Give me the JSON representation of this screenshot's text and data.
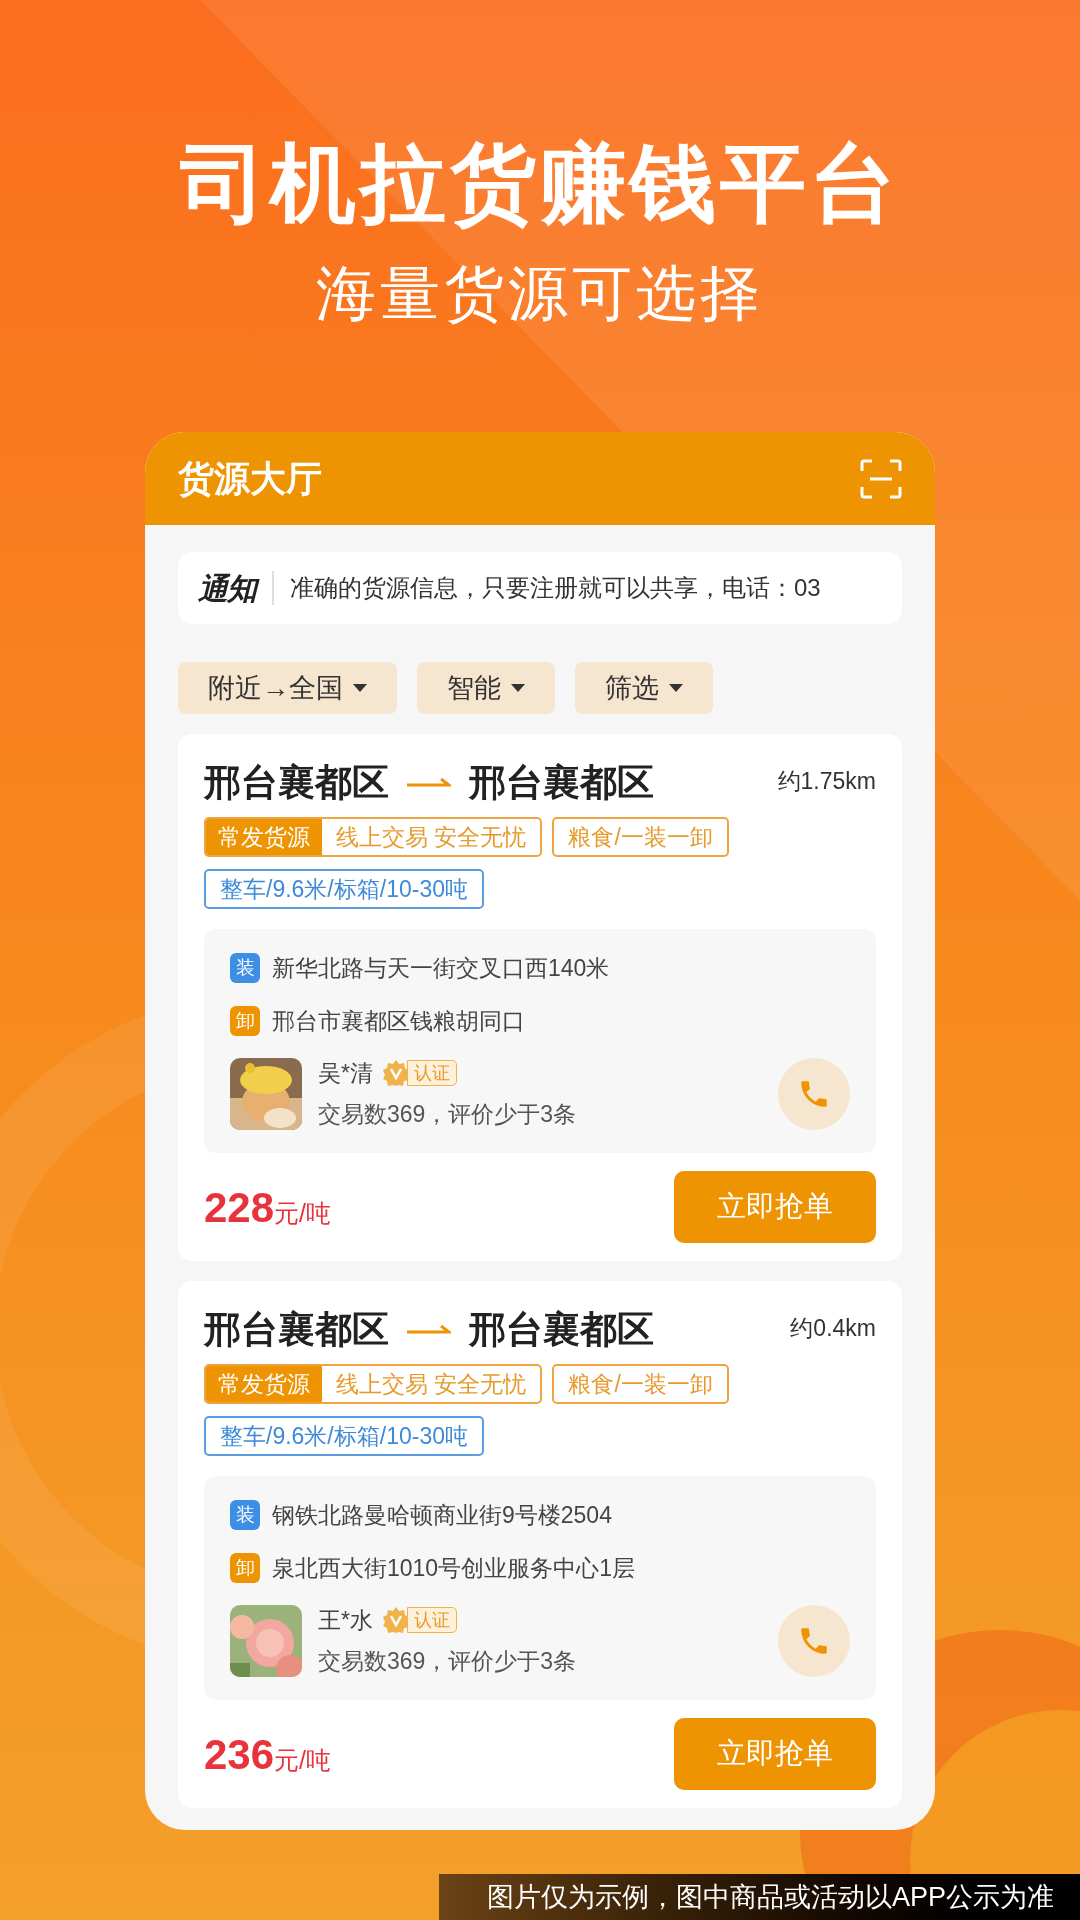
{
  "headline": "司机拉货赚钱平台",
  "subheadline": "海量货源可选择",
  "app": {
    "title": "货源大厅",
    "notice": {
      "label": "通知",
      "text": "准确的货源信息，只要注册就可以共享，电话：03"
    },
    "filters": [
      "附近→全国",
      "智能",
      "筛选"
    ],
    "orders": [
      {
        "from": "邢台襄都区",
        "to": "邢台襄都区",
        "distance": "约1.75km",
        "badge": "常发货源",
        "badge_note": "线上交易 安全无忧",
        "cargo": "粮食/一装一卸",
        "vehicle": "整车/9.6米/标箱/10-30吨",
        "load_label": "装",
        "load": "新华北路与天一街交叉口西140米",
        "unload_label": "卸",
        "unload": "邢台市襄都区钱粮胡同口",
        "shipper": "吴*清",
        "verified": "认证",
        "stats": "交易数369，评价少于3条",
        "price": "228",
        "unit": "元/吨",
        "action": "立即抢单"
      },
      {
        "from": "邢台襄都区",
        "to": "邢台襄都区",
        "distance": "约0.4km",
        "badge": "常发货源",
        "badge_note": "线上交易 安全无忧",
        "cargo": "粮食/一装一卸",
        "vehicle": "整车/9.6米/标箱/10-30吨",
        "load_label": "装",
        "load": "钢铁北路曼哈顿商业街9号楼2504",
        "unload_label": "卸",
        "unload": "泉北西大街1010号创业服务中心1层",
        "shipper": "王*水",
        "verified": "认证",
        "stats": "交易数369，评价少于3条",
        "price": "236",
        "unit": "元/吨",
        "action": "立即抢单"
      }
    ]
  },
  "disclaimer": "图片仅为示例，图中商品或活动以APP公示为准"
}
